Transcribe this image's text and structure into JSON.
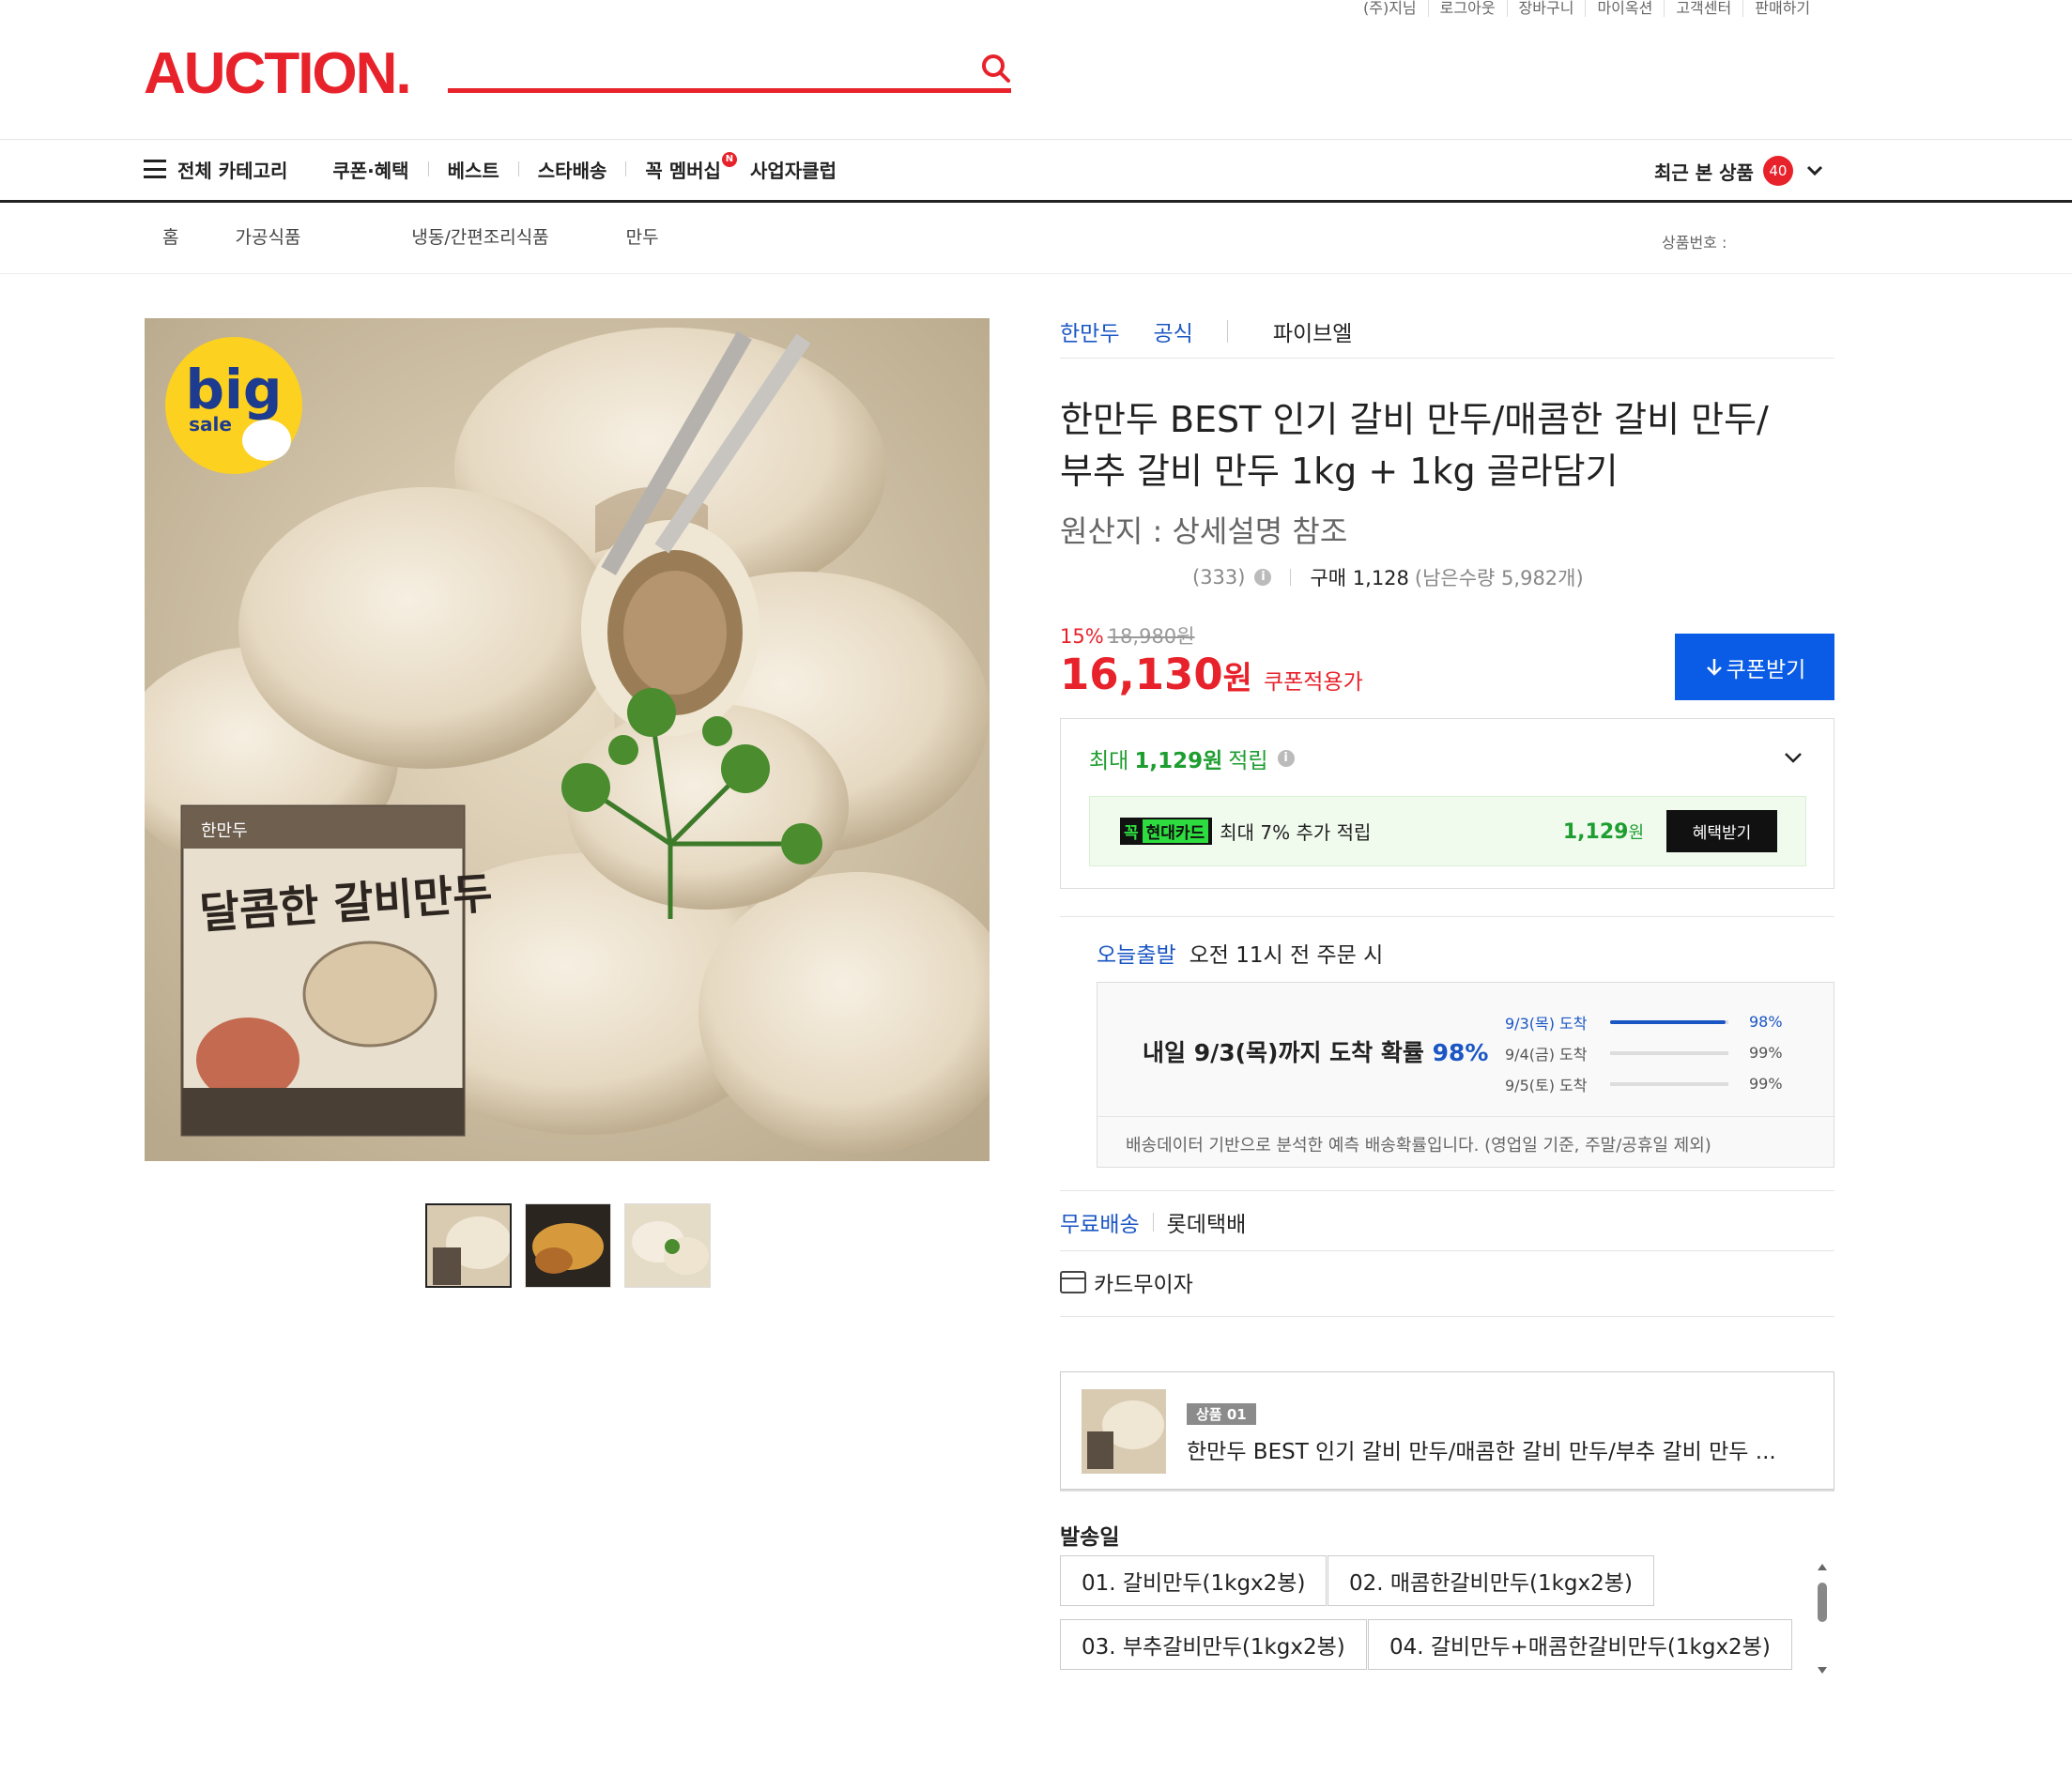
{
  "utility_links": [
    "(주)지님",
    "로그아웃",
    "장바구니",
    "마이옥션",
    "고객센터",
    "판매하기"
  ],
  "header": {
    "logo": "AUCTION."
  },
  "gnb": {
    "all_category": "전체 카테고리",
    "items": [
      "쿠폰·혜택",
      "베스트",
      "스타배송",
      "꼭 멤버십",
      "사업자클럽"
    ],
    "membership_badge": "N",
    "recent_label": "최근 본 상품",
    "recent_count": "40"
  },
  "breadcrumb": [
    "홈",
    "가공식품",
    "냉동/간편조리식품",
    "만두"
  ],
  "product_no_label": "상품번호 :",
  "image_badge": {
    "line1": "big",
    "line2": "sale"
  },
  "package_text": {
    "brand": "한만두",
    "name": "달콤한 갈비만두"
  },
  "product": {
    "tags": [
      "한만두",
      "공식",
      "파이브엘"
    ],
    "title": "한만두 BEST 인기 갈비 만두/매콤한 갈비 만두/부추 갈비 만두 1kg + 1kg 골라담기",
    "origin": "원산지 : 상세설명 참조",
    "reviews": "(333)",
    "purchase": "구매 1,128",
    "remaining": "(남은수량 5,982개)",
    "discount_pct": "15%",
    "original_price": "18,980원",
    "price": "16,130",
    "price_unit": "원",
    "coupon_price_label": "쿠폰적용가",
    "coupon_button": "쿠폰받기"
  },
  "reward": {
    "prefix": "최대",
    "amount": "1,129원",
    "suffix": "적립",
    "card_logo_a": "꼭",
    "card_logo_b": "현대카드",
    "card_text": "최대 7% 추가 적립",
    "card_amount": "1,129",
    "card_amount_unit": "원",
    "benefit_button": "혜택받기"
  },
  "delivery": {
    "today_label": "오늘출발",
    "today_text": "오전 11시 전 주문 시",
    "arrival_head": "내일 9/3(목)까지 도착 확률",
    "arrival_pct": "98%",
    "rows": [
      {
        "label": "9/3(목) 도착",
        "pct": "98%",
        "value": 0.98
      },
      {
        "label": "9/4(금) 도착",
        "pct": "99%",
        "value": 0.0
      },
      {
        "label": "9/5(토) 도착",
        "pct": "99%",
        "value": 0.0
      }
    ],
    "note": "배송데이터 기반으로 분석한 예측 배송확률입니다. (영업일 기준, 주말/공휴일 제외)",
    "free_ship": "무료배송",
    "carrier": "롯데택배",
    "card_interest_free": "카드무이자"
  },
  "selected_product": {
    "badge": "상품 01",
    "name": "한만두 BEST 인기 갈비 만두/매콤한 갈비 만두/부추 갈비 만두 ..."
  },
  "options": {
    "label": "발송일",
    "items": [
      "01. 갈비만두(1kgx2봉)",
      "02. 매콤한갈비만두(1kgx2봉)",
      "03. 부추갈비만두(1kgx2봉)",
      "04. 갈비만두+매콤한갈비만두(1kgx2봉)"
    ]
  }
}
